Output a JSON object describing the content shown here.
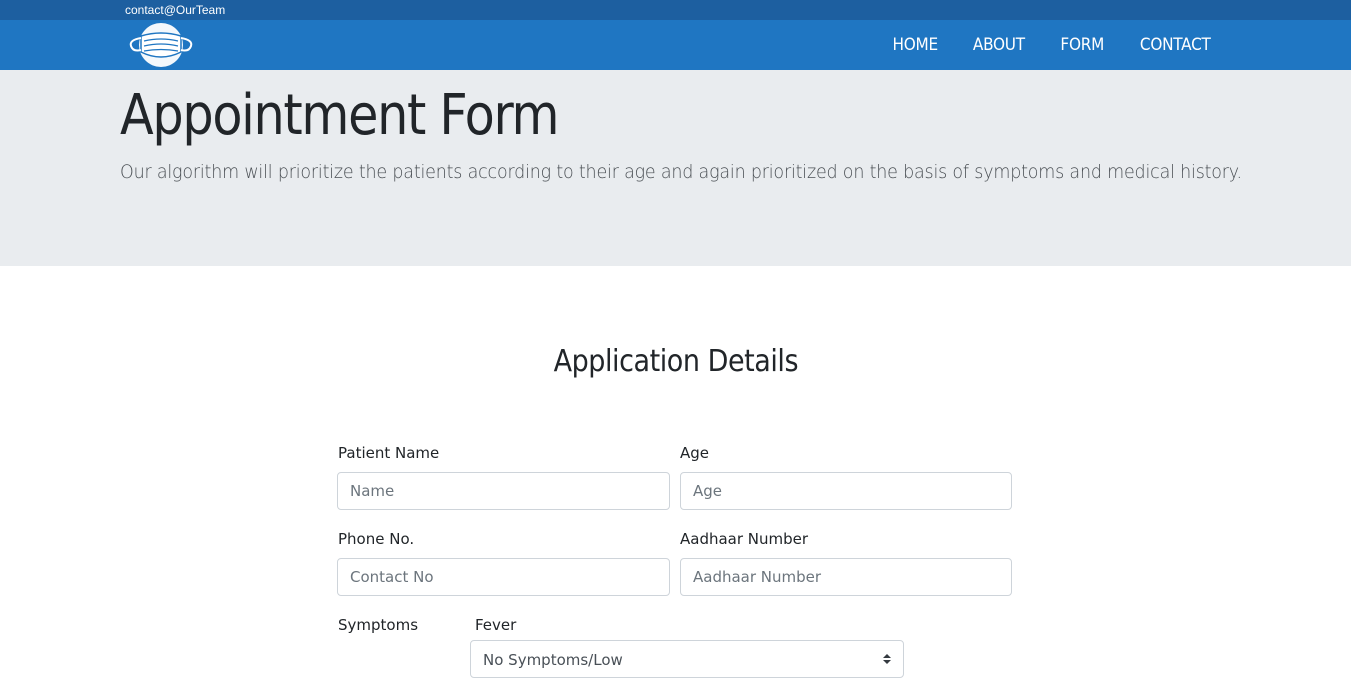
{
  "topbar": {
    "contact": "contact@OurTeam"
  },
  "navbar": {
    "logo_icon": "face-mask-icon",
    "links": [
      "HOME",
      "ABOUT",
      "FORM",
      "CONTACT"
    ]
  },
  "jumbotron": {
    "title": "Appointment Form",
    "subtitle": "Our algorithm will prioritize the patients according to their age and again prioritized on the basis of symptoms and medical history."
  },
  "form": {
    "heading": "Application Details",
    "patient_name": {
      "label": "Patient Name",
      "placeholder": "Name"
    },
    "age": {
      "label": "Age",
      "placeholder": "Age"
    },
    "phone": {
      "label": "Phone No.",
      "placeholder": "Contact No"
    },
    "aadhaar": {
      "label": "Aadhaar Number",
      "placeholder": "Aadhaar Number"
    },
    "symptoms_label": "Symptoms",
    "fever": {
      "label": "Fever",
      "selected": "No Symptoms/Low"
    }
  },
  "colors": {
    "topbar": "#1d5fa0",
    "navbar": "#1f76c2",
    "jumbotron": "#e9ecef"
  }
}
